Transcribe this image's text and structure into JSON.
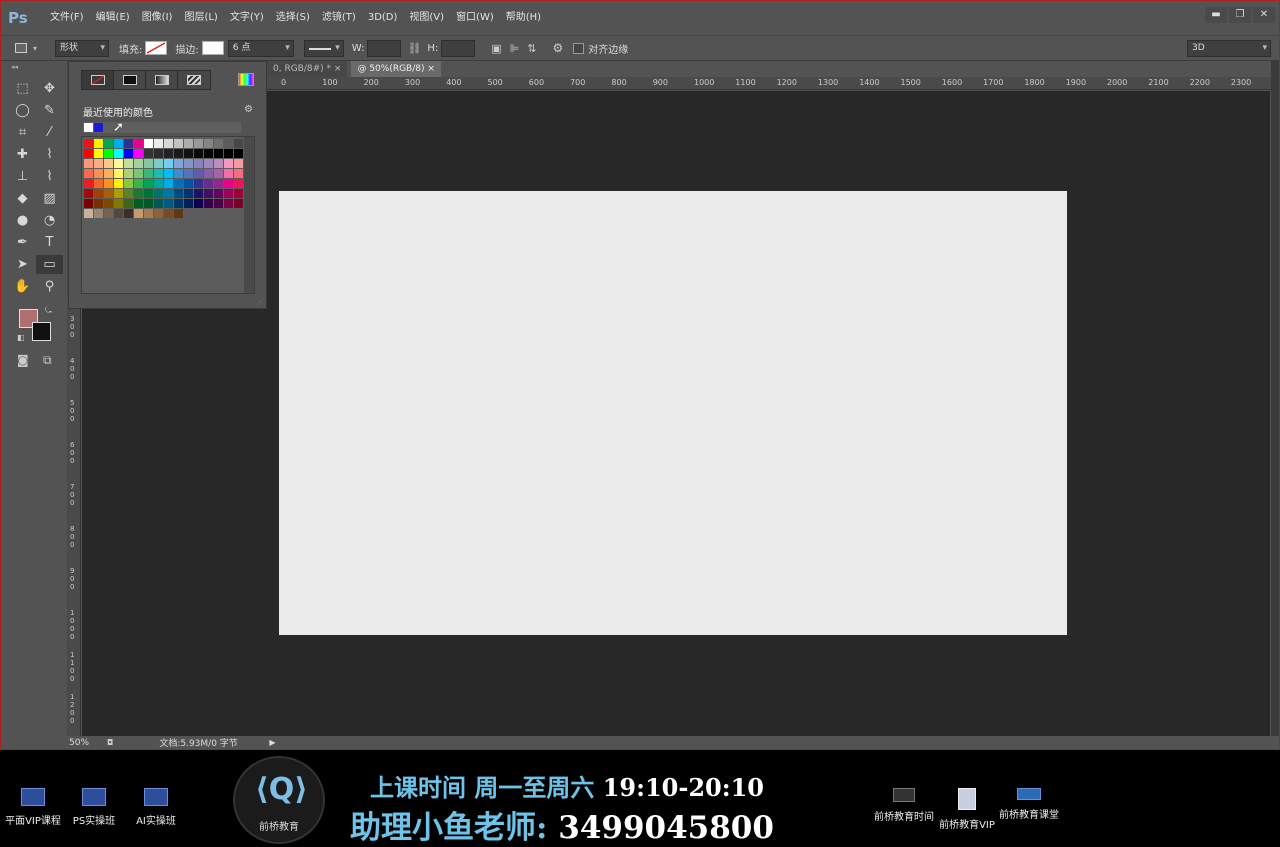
{
  "app": {
    "logo": "Ps",
    "menu": [
      "文件(F)",
      "编辑(E)",
      "图像(I)",
      "图层(L)",
      "文字(Y)",
      "选择(S)",
      "滤镜(T)",
      "3D(D)",
      "视图(V)",
      "窗口(W)",
      "帮助(H)"
    ],
    "window_buttons": [
      "▬",
      "❐",
      "✕"
    ]
  },
  "options": {
    "mode": "形状",
    "fill_label": "填充:",
    "stroke_label": "描边:",
    "stroke_size": "6 点",
    "w_label": "W:",
    "h_label": "H:",
    "align_edges": "对齐边缘",
    "workspace": "3D"
  },
  "tabs": [
    {
      "label": "0, RGB/8#) *",
      "active": false
    },
    {
      "label": "@ 50%(RGB/8)",
      "active": true
    }
  ],
  "ruler_top": [
    "0",
    "100",
    "200",
    "300",
    "400",
    "500",
    "600",
    "700",
    "800",
    "900",
    "1000",
    "1100",
    "1200",
    "1300",
    "1400",
    "1500",
    "1600",
    "1700",
    "1800",
    "1900",
    "2000",
    "2100",
    "2200",
    "2300"
  ],
  "ruler_left": [
    "300",
    "400",
    "500",
    "600",
    "700",
    "800",
    "900",
    "1000",
    "1100",
    "1200"
  ],
  "swatches": {
    "recent_title": "最近使用的颜色",
    "recent_colors": [
      "#ffffff",
      "#1a1ad8"
    ],
    "grid_colors": [
      "#e8141c",
      "#fff200",
      "#00a651",
      "#00aeef",
      "#2e3192",
      "#ec008c",
      "#ffffff",
      "#ebebeb",
      "#d7d7d7",
      "#c2c2c2",
      "#adadad",
      "#999999",
      "#858585",
      "#707070",
      "#5c5c5c",
      "#474747",
      "#ff0000",
      "#ffff00",
      "#00ff00",
      "#00ffff",
      "#0000ff",
      "#ff00ff",
      "#333333",
      "#2b2b2b",
      "#222222",
      "#1a1a1a",
      "#111111",
      "#0a0a0a",
      "#050505",
      "#000000",
      "#000000",
      "#000000",
      "#f7977a",
      "#f9ad81",
      "#fdc68a",
      "#fff79a",
      "#c4df9b",
      "#a3d39c",
      "#82ca9d",
      "#7bcdc8",
      "#6ecff6",
      "#7ea7d8",
      "#8493ca",
      "#8882be",
      "#a187be",
      "#bc8dbf",
      "#f49ac2",
      "#f6989d",
      "#f26c4f",
      "#f68e55",
      "#fbaf5c",
      "#fff467",
      "#acd372",
      "#7cc576",
      "#3bb878",
      "#1abbb4",
      "#00bff3",
      "#438ccb",
      "#5574b9",
      "#605ca8",
      "#855fa8",
      "#a763a8",
      "#f06ea9",
      "#f26d7d",
      "#ed1c24",
      "#f26522",
      "#f7941d",
      "#fff200",
      "#8dc73f",
      "#39b54a",
      "#00a651",
      "#00a99d",
      "#00aeef",
      "#0072bc",
      "#0054a6",
      "#2e3192",
      "#662d91",
      "#92278f",
      "#ec008c",
      "#ed145b",
      "#9e0b0f",
      "#a0410d",
      "#a36209",
      "#aba000",
      "#598527",
      "#1a7b30",
      "#007236",
      "#00746b",
      "#0076a3",
      "#004b80",
      "#003471",
      "#1b1464",
      "#440e62",
      "#630460",
      "#9e005d",
      "#9e0039",
      "#790000",
      "#7b2e00",
      "#7d4900",
      "#827b00",
      "#406618",
      "#005e20",
      "#005826",
      "#005952",
      "#005b7f",
      "#003663",
      "#002157",
      "#0d004c",
      "#32004b",
      "#4b0049",
      "#7b0046",
      "#7a0026",
      "#c7b299",
      "#998675",
      "#736357",
      "#534741",
      "#37302d",
      "#c69c6d",
      "#a67c52",
      "#8c6239",
      "#754c24",
      "#603913",
      "",
      "",
      "",
      "",
      "",
      ""
    ]
  },
  "status": {
    "zoom": "50%",
    "doc": "文档:5.93M/0 字节"
  },
  "banner": {
    "left_items": [
      "平面VIP课程",
      "PS实操班",
      "AI实操班"
    ],
    "logo_text": "前桥教育",
    "line1_prefix": "上课时间 周一至周六 ",
    "line1_time": "19:10-20:10",
    "line2_prefix": "助理小鱼老师: ",
    "line2_number": "3499045800",
    "right_items": [
      "前桥教育时间",
      "前桥教育VIP",
      "前桥教育课堂"
    ]
  }
}
